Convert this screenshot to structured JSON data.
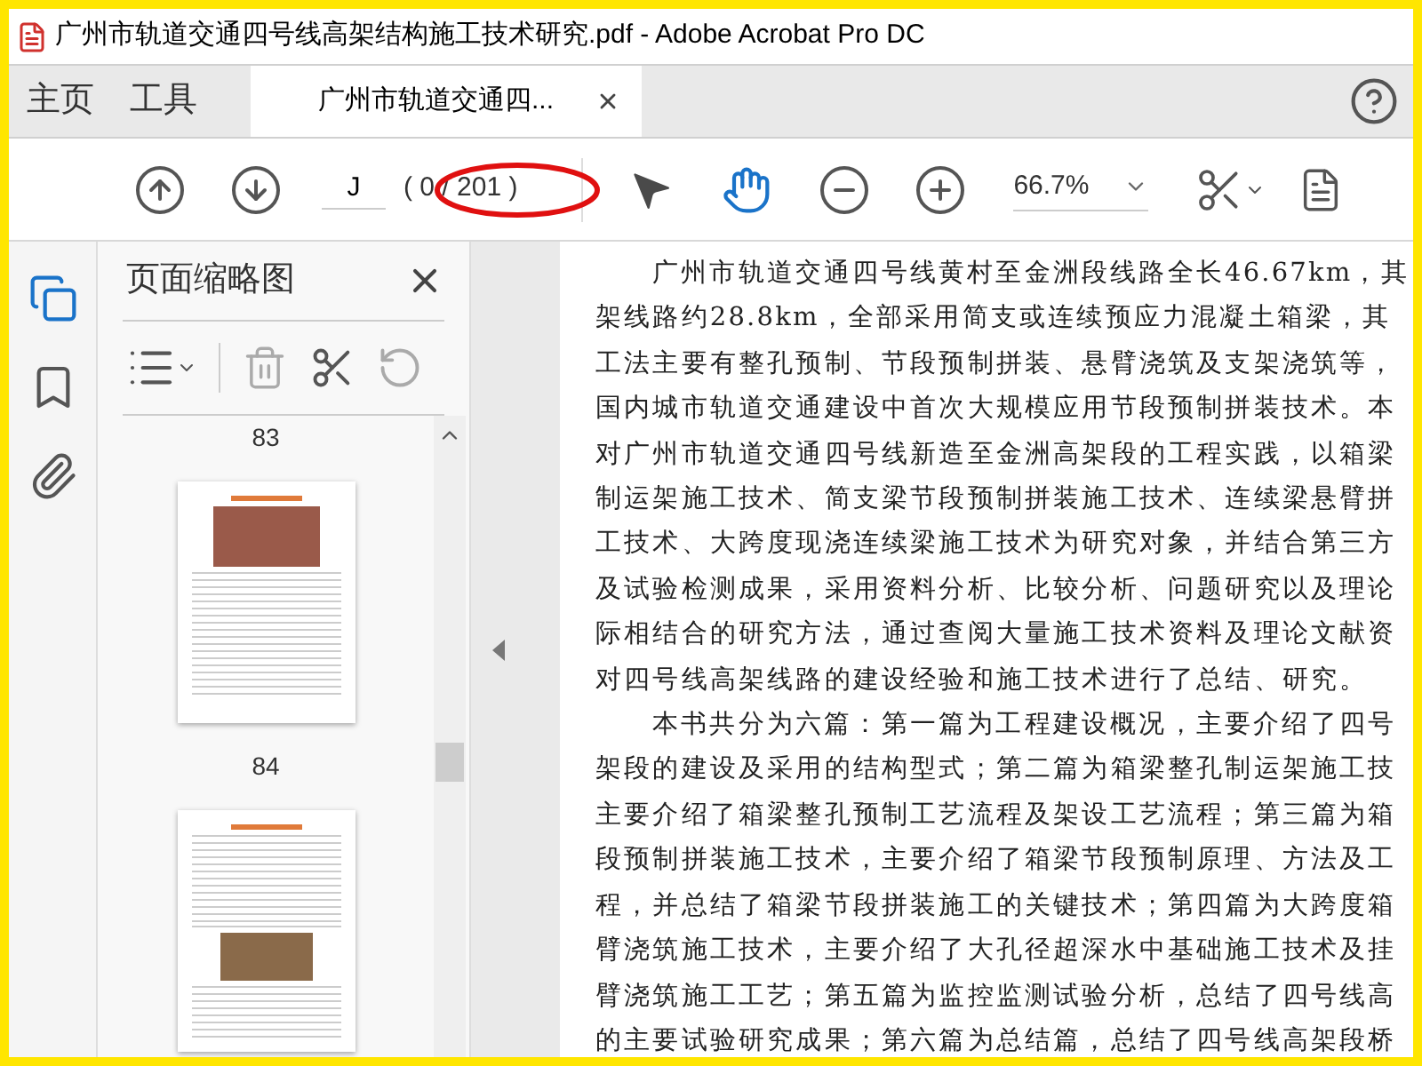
{
  "window": {
    "title": "广州市轨道交通四号线高架结构施工技术研究.pdf - Adobe Acrobat Pro DC"
  },
  "tabs": [
    {
      "label": "主页",
      "kind": "nav",
      "selected": false
    },
    {
      "label": "工具",
      "kind": "nav",
      "selected": false
    },
    {
      "label": "广州市轨道交通四...",
      "kind": "document",
      "selected": true
    }
  ],
  "toolbar": {
    "page_field": {
      "value": "J"
    },
    "page_count": "( 0 / 201 )",
    "highlight_ellipse": true,
    "zoom": "66.7%",
    "tools": [
      {
        "kind": "select",
        "selected": false
      },
      {
        "kind": "hand",
        "selected": true
      }
    ]
  },
  "sidebar": {
    "rail": [
      {
        "kind": "pages",
        "selected": true
      },
      {
        "kind": "bookmarks",
        "selected": false
      },
      {
        "kind": "attachments",
        "selected": false
      }
    ],
    "panel_title": "页面缩略图",
    "thumbnails": [
      {
        "label": "83",
        "kind": "photo_table"
      },
      {
        "label": "84",
        "kind": "text_photo"
      }
    ]
  },
  "document": {
    "paragraphs": [
      {
        "lines": [
          "广州市轨道交通四号线黄村至金洲段线路全长46.67km，其",
          "架线路约28.8km，全部采用简支或连续预应力混凝土箱梁，其",
          "工法主要有整孔预制、节段预制拼装、悬臂浇筑及支架浇筑等，",
          "国内城市轨道交通建设中首次大规模应用节段预制拼装技术。本",
          "对广州市轨道交通四号线新造至金洲高架段的工程实践，以箱梁",
          "制运架施工技术、简支梁节段预制拼装施工技术、连续梁悬臂拼",
          "工技术、大跨度现浇连续梁施工技术为研究对象，并结合第三方",
          "及试验检测成果，采用资料分析、比较分析、问题研究以及理论",
          "际相结合的研究方法，通过查阅大量施工技术资料及理论文献资",
          "对四号线高架线路的建设经验和施工技术进行了总结、研究。"
        ]
      },
      {
        "lines": [
          "本书共分为六篇：第一篇为工程建设概况，主要介绍了四号",
          "架段的建设及采用的结构型式；第二篇为箱梁整孔制运架施工技",
          "主要介绍了箱梁整孔预制工艺流程及架设工艺流程；第三篇为箱",
          "段预制拼装施工技术，主要介绍了箱梁节段预制原理、方法及工",
          "程，并总结了箱梁节段拼装施工的关键技术；第四篇为大跨度箱",
          "臂浇筑施工技术，主要介绍了大孔径超深水中基础施工技术及挂",
          "臂浇筑施工工艺；第五篇为监控监测试验分析，总结了四号线高",
          "的主要试验研究成果；第六篇为总结篇，总结了四号线高架段桥"
        ]
      }
    ]
  }
}
